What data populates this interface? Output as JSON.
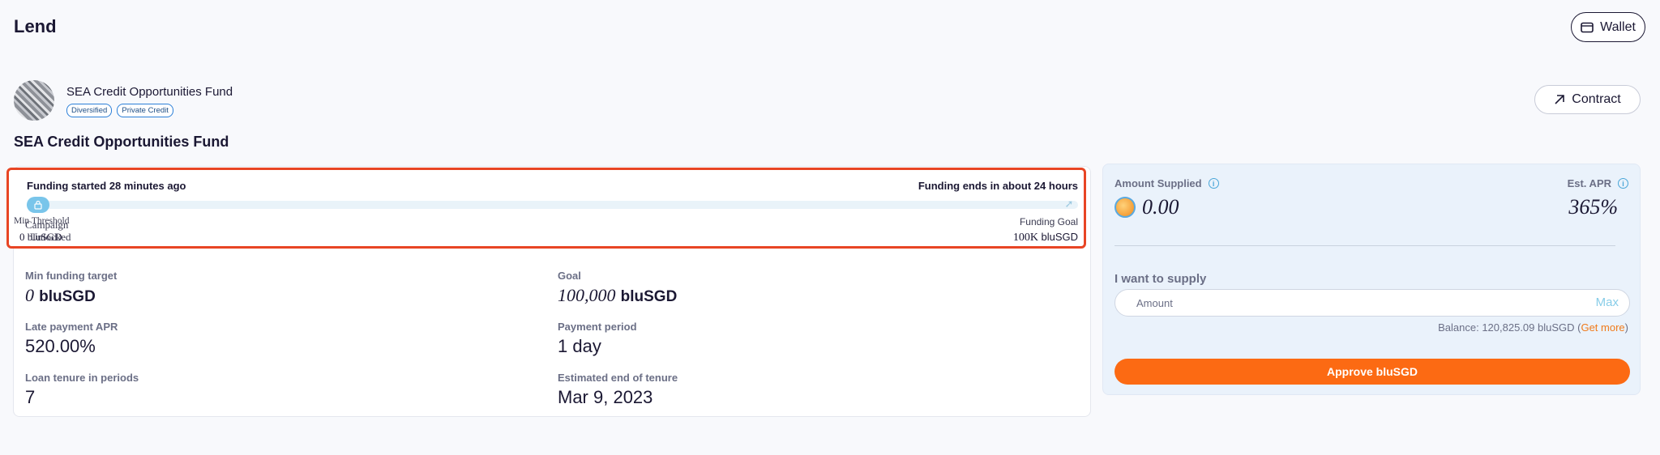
{
  "page": {
    "title": "Lend"
  },
  "header": {
    "wallet_label": "Wallet",
    "contract_label": "Contract"
  },
  "fund": {
    "name": "SEA Credit Opportunities Fund",
    "title": "SEA Credit Opportunities Fund",
    "tags": [
      "Diversified",
      "Private Credit"
    ]
  },
  "funding": {
    "started": "Funding started 28 minutes ago",
    "ends": "Funding ends in about 24 hours",
    "min_threshold_label": "Min Threshold",
    "campaign_label": "Campaign",
    "min_value": "0 bluSGD",
    "unlocked_label": "Unlocked",
    "goal_label": "Funding Goal",
    "goal_value": "100K",
    "goal_unit": "bluSGD",
    "progress_fraction": 0.0
  },
  "stats": {
    "min_target_label": "Min funding target",
    "min_target_value": "0",
    "min_target_unit": "bluSGD",
    "goal_label": "Goal",
    "goal_value": "100,000",
    "goal_unit": "bluSGD",
    "late_apr_label": "Late payment APR",
    "late_apr_value": "520.00%",
    "payment_period_label": "Payment period",
    "payment_period_value": "1 day",
    "tenure_label": "Loan tenure in periods",
    "tenure_value": "7",
    "end_tenure_label": "Estimated end of tenure",
    "end_tenure_value": "Mar 9, 2023"
  },
  "supply": {
    "amount_supplied_label": "Amount Supplied",
    "amount_supplied_value": "0.00",
    "est_apr_label": "Est. APR",
    "est_apr_value": "365%",
    "want_label": "I want to supply",
    "input_placeholder": "Amount",
    "max_label": "Max",
    "balance_text": "Balance: 120,825.09 bluSGD (",
    "get_more_label": "Get more",
    "balance_close": ")",
    "approve_label": "Approve bluSGD"
  },
  "colors": {
    "accent": "#fc6a13",
    "highlight_border": "#e84524",
    "track": "#e9f3f9",
    "handle": "#79c5ea"
  }
}
